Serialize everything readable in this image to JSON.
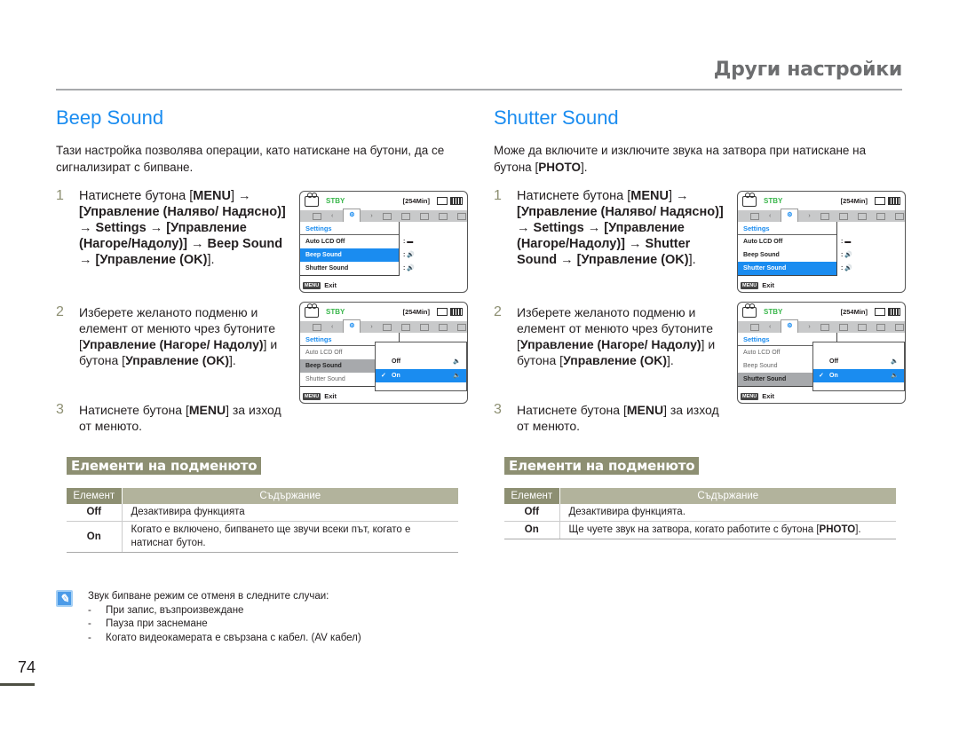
{
  "header": {
    "chapter_title": "Други настройки"
  },
  "left": {
    "title": "Beep Sound",
    "intro": "Тази настройка позволява операции, като натискане на бутони, да се сигнализират с бипване.",
    "steps": [
      {
        "num": "1",
        "parts": [
          {
            "t": "Натиснете бутона [",
            "b": false
          },
          {
            "t": "MENU",
            "b": true
          },
          {
            "t": "] ",
            "b": false
          },
          {
            "t": "→ [Управление (Наляво/ Надясно)] → Settings → [Управление (Нагоре/Надолу)] → Beep Sound → [Управление (OK)",
            "b": true
          },
          {
            "t": "].",
            "b": false
          }
        ]
      },
      {
        "num": "2",
        "parts": [
          {
            "t": "Изберете желаното подменю и елемент от менюто чрез бутоните [",
            "b": false
          },
          {
            "t": "Управление (Нагоре/ Надолу)",
            "b": true
          },
          {
            "t": "] и бутона [",
            "b": false
          },
          {
            "t": "Управление (OK)",
            "b": true
          },
          {
            "t": "].",
            "b": false
          }
        ]
      },
      {
        "num": "3",
        "parts": [
          {
            "t": "Натиснете бутона [",
            "b": false
          },
          {
            "t": "MENU",
            "b": true
          },
          {
            "t": "] за изход от менюто.",
            "b": false
          }
        ]
      }
    ],
    "lcd1": {
      "status": "STBY",
      "remaining": "[254Min]",
      "menu_header": "Settings",
      "items": [
        "Auto LCD Off",
        "Beep Sound",
        "Shutter Sound"
      ],
      "selected": 1,
      "footer": "Exit",
      "menu_key": "MENU"
    },
    "lcd2": {
      "status": "STBY",
      "remaining": "[254Min]",
      "menu_header": "Settings",
      "items": [
        "Auto LCD Off",
        "Beep Sound",
        "Shutter Sound"
      ],
      "selected": 1,
      "options": [
        "Off",
        "On"
      ],
      "option_selected": 1,
      "footer": "Exit",
      "menu_key": "MENU"
    },
    "submenu_title": "Елементи на подменюто",
    "table": {
      "headers": [
        "Елемент",
        "Съдържание"
      ],
      "rows": [
        {
          "item": "Off",
          "desc": "Дезактивира функцията"
        },
        {
          "item": "On",
          "desc": "Когато е включено, бипването ще звучи всеки път, когато е натиснат бутон."
        }
      ]
    }
  },
  "right": {
    "title": "Shutter Sound",
    "intro_pre": "Може да включите и изключите звука на затвора при натискане на бутона [",
    "intro_bold": "PHOTO",
    "intro_post": "].",
    "steps": [
      {
        "num": "1",
        "parts": [
          {
            "t": "Натиснете бутона [",
            "b": false
          },
          {
            "t": "MENU",
            "b": true
          },
          {
            "t": "] ",
            "b": false
          },
          {
            "t": "→ [Управление (Наляво/ Надясно)] → Settings → [Управление (Нагоре/Надолу)] → Shutter Sound → [Управление (OK)",
            "b": true
          },
          {
            "t": "].",
            "b": false
          }
        ]
      },
      {
        "num": "2",
        "parts": [
          {
            "t": "Изберете желаното подменю и елемент от менюто чрез бутоните [",
            "b": false
          },
          {
            "t": "Управление (Нагоре/ Надолу)",
            "b": true
          },
          {
            "t": "] и бутона [",
            "b": false
          },
          {
            "t": "Управление (OK)",
            "b": true
          },
          {
            "t": "].",
            "b": false
          }
        ]
      },
      {
        "num": "3",
        "parts": [
          {
            "t": "Натиснете бутона [",
            "b": false
          },
          {
            "t": "MENU",
            "b": true
          },
          {
            "t": "] за изход от менюто.",
            "b": false
          }
        ]
      }
    ],
    "lcd1": {
      "status": "STBY",
      "remaining": "[254Min]",
      "menu_header": "Settings",
      "items": [
        "Auto LCD Off",
        "Beep Sound",
        "Shutter Sound"
      ],
      "selected": 2,
      "footer": "Exit",
      "menu_key": "MENU"
    },
    "lcd2": {
      "status": "STBY",
      "remaining": "[254Min]",
      "menu_header": "Settings",
      "items": [
        "Auto LCD Off",
        "Beep Sound",
        "Shutter Sound"
      ],
      "selected": 2,
      "options": [
        "Off",
        "On"
      ],
      "option_selected": 1,
      "footer": "Exit",
      "menu_key": "MENU"
    },
    "submenu_title": "Елементи на подменюто",
    "table": {
      "headers": [
        "Елемент",
        "Съдържание"
      ],
      "rows": [
        {
          "item": "Off",
          "desc": "Дезактивира функцията."
        },
        {
          "item": "On",
          "desc_pre": "Ще чуете звук на затвора, когато работите с бутона [",
          "desc_bold": "PHOTO",
          "desc_post": "]."
        }
      ]
    }
  },
  "note": {
    "icon": "note-pencil-icon",
    "lead": "Звук бипване режим се отменя в следните случаи:",
    "items": [
      "При запис, възпроизвеждане",
      "Пауза при заснемане",
      "Когато видеокамерата е свързана с кабел. (AV кабел)"
    ]
  },
  "page_number": "74",
  "colors": {
    "accent_blue": "#1a8cf0",
    "olive": "#8d8f72",
    "stby_green": "#38b64a"
  }
}
